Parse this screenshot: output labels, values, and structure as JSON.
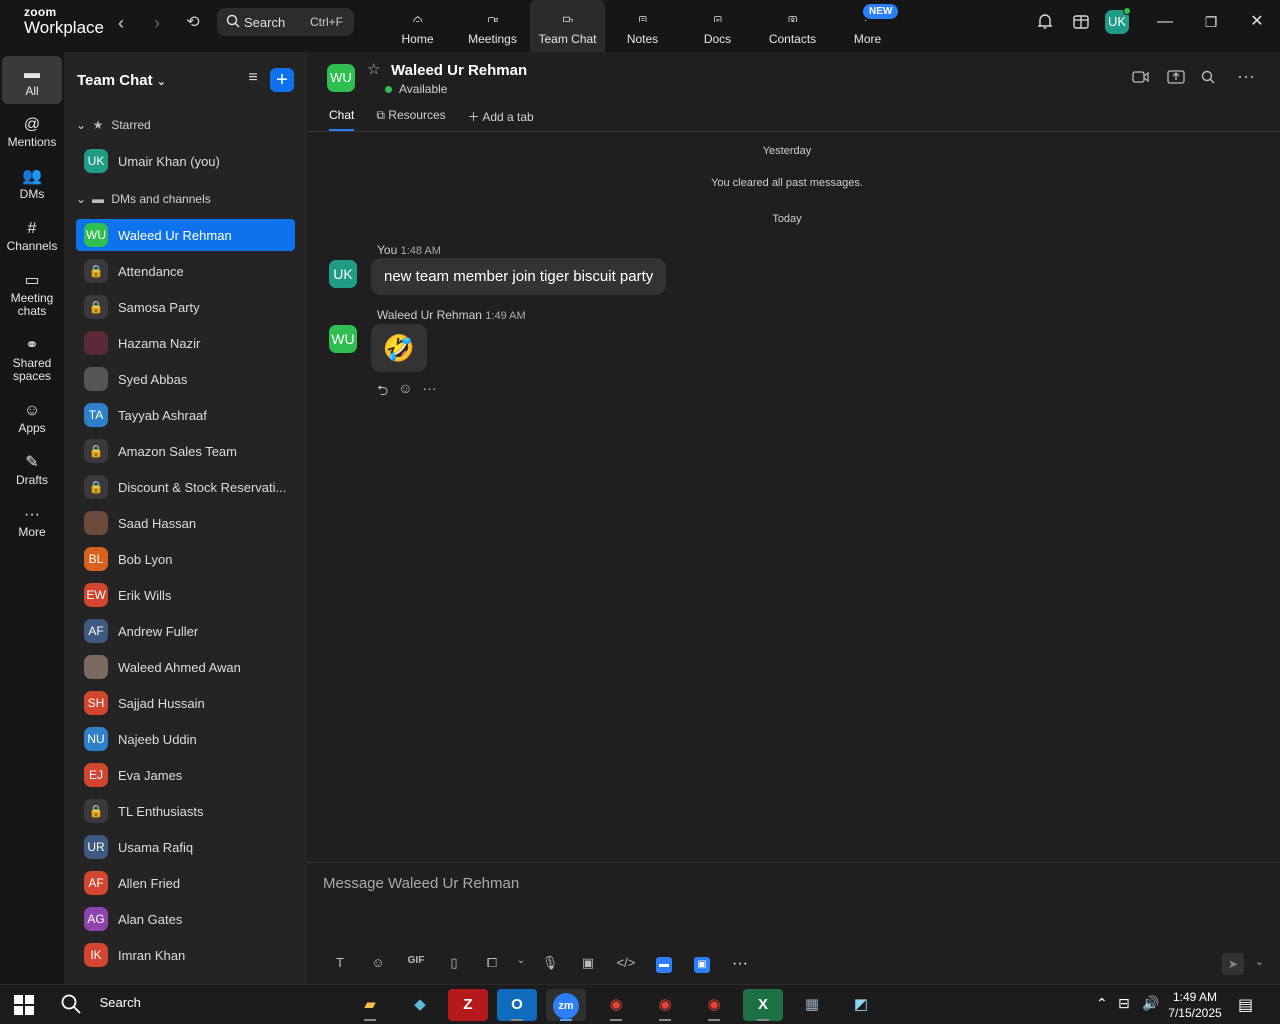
{
  "app": {
    "logo_line1": "zoom",
    "logo_line2": "Workplace"
  },
  "topbar": {
    "search_label": "Search",
    "search_shortcut": "Ctrl+F",
    "nav": [
      {
        "label": "Home",
        "icon": "home-icon"
      },
      {
        "label": "Meetings",
        "icon": "video-camera-icon"
      },
      {
        "label": "Team Chat",
        "icon": "chat-bubbles-icon"
      },
      {
        "label": "Notes",
        "icon": "notes-icon"
      },
      {
        "label": "Docs",
        "icon": "document-icon"
      },
      {
        "label": "Contacts",
        "icon": "contacts-icon"
      },
      {
        "label": "More",
        "icon": "more-dots-icon"
      }
    ],
    "new_badge": "NEW",
    "user_initials": "UK"
  },
  "rail": [
    {
      "label": "All",
      "icon": "chat-icon"
    },
    {
      "label": "Mentions",
      "icon": "at-icon"
    },
    {
      "label": "DMs",
      "icon": "people-icon"
    },
    {
      "label": "Channels",
      "icon": "hash-icon"
    },
    {
      "label": "Meeting chats",
      "icon": "calendar-icon"
    },
    {
      "label": "Shared spaces",
      "icon": "share-icon"
    },
    {
      "label": "Apps",
      "icon": "apps-icon"
    },
    {
      "label": "Drafts",
      "icon": "drafts-icon"
    },
    {
      "label": "More",
      "icon": "more-dots-icon"
    }
  ],
  "sidebar": {
    "title": "Team Chat",
    "starred_label": "Starred",
    "dms_label": "DMs and channels",
    "starred": [
      {
        "name": "Umair Khan (you)",
        "initials": "UK",
        "color": "#1f9c86"
      }
    ],
    "items": [
      {
        "name": "Waleed Ur Rehman",
        "initials": "WU",
        "color": "#2fbf51"
      },
      {
        "name": "Attendance",
        "initials": "🔒",
        "color": "#3a3a3a"
      },
      {
        "name": "Samosa Party",
        "initials": "🔒",
        "color": "#3a3a3a"
      },
      {
        "name": "Hazama Nazir",
        "initials": "",
        "color": "#5a2b36"
      },
      {
        "name": "Syed Abbas",
        "initials": "",
        "color": "#555555"
      },
      {
        "name": "Tayyab Ashraaf",
        "initials": "TA",
        "color": "#2f80c9"
      },
      {
        "name": "Amazon Sales Team",
        "initials": "🔒",
        "color": "#3a3a3a"
      },
      {
        "name": "Discount & Stock Reservati...",
        "initials": "🔒",
        "color": "#3a3a3a"
      },
      {
        "name": "Saad Hassan",
        "initials": "",
        "color": "#6a4a3a"
      },
      {
        "name": "Bob Lyon",
        "initials": "BL",
        "color": "#d9611e"
      },
      {
        "name": "Erik Wills",
        "initials": "EW",
        "color": "#d2452f"
      },
      {
        "name": "Andrew Fuller",
        "initials": "AF",
        "color": "#3d5a80"
      },
      {
        "name": "Waleed Ahmed Awan",
        "initials": "",
        "color": "#7a6a60"
      },
      {
        "name": "Sajjad Hussain",
        "initials": "SH",
        "color": "#d2452f"
      },
      {
        "name": "Najeeb Uddin",
        "initials": "NU",
        "color": "#2f80c9"
      },
      {
        "name": "Eva James",
        "initials": "EJ",
        "color": "#d2452f"
      },
      {
        "name": "TL Enthusiasts",
        "initials": "🔒",
        "color": "#3a3a3a"
      },
      {
        "name": "Usama Rafiq",
        "initials": "UR",
        "color": "#3d5a80"
      },
      {
        "name": "Allen Fried",
        "initials": "AF",
        "color": "#d2452f"
      },
      {
        "name": "Alan Gates",
        "initials": "AG",
        "color": "#8e44ad"
      },
      {
        "name": "Imran Khan",
        "initials": "IK",
        "color": "#d2452f"
      }
    ]
  },
  "chat": {
    "contact_initials": "WU",
    "contact_name": "Waleed Ur Rehman",
    "status": "Available",
    "tabs": [
      "Chat",
      "Resources",
      "Add a tab"
    ],
    "day_yesterday": "Yesterday",
    "cleared_notice": "You cleared all past messages.",
    "day_today": "Today",
    "messages": [
      {
        "sender": "You",
        "time": "1:48 AM",
        "initials": "UK",
        "color": "#1f9c86",
        "text": "new team member join tiger biscuit party"
      },
      {
        "sender": "Waleed Ur Rehman",
        "time": "1:49 AM",
        "initials": "WU",
        "color": "#2fbf51",
        "text": "🤣"
      }
    ],
    "composer_placeholder": "Message Waleed Ur Rehman",
    "gif_label": "GIF"
  },
  "taskbar": {
    "search_label": "Search",
    "time": "1:49 AM",
    "date": "7/15/2025"
  }
}
